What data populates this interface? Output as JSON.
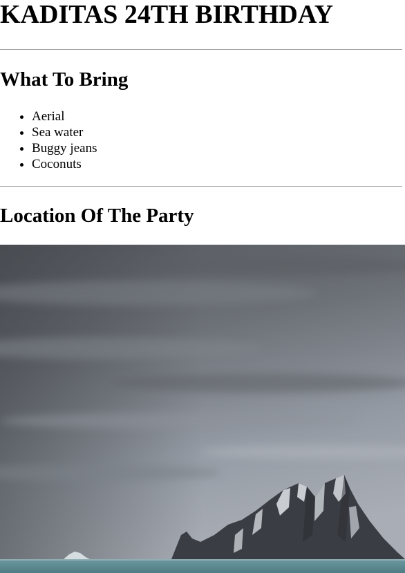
{
  "page": {
    "title": "KADITAS 24TH BIRTHDAY"
  },
  "bring_section": {
    "heading": "What To Bring",
    "items": [
      "Aerial",
      "Sea water",
      "Buggy jeans",
      "Coconuts"
    ]
  },
  "location_section": {
    "heading": "Location Of The Party",
    "image": "island-mountain-sea-photo"
  },
  "colors": {
    "divider": "#9a9a9a",
    "sky": "#6b7078",
    "sea": "#5f8e93",
    "rock": "#3c3f45"
  }
}
